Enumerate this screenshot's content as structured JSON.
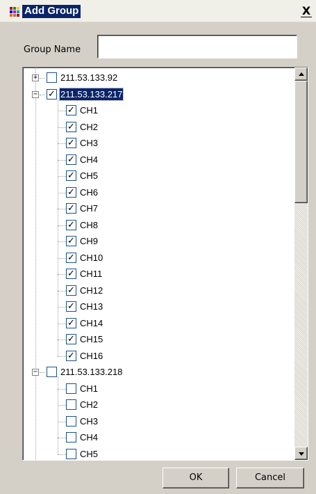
{
  "window": {
    "title": "Add Group",
    "close_label": "X"
  },
  "form": {
    "group_name_label": "Group Name",
    "group_name_value": ""
  },
  "tree": {
    "nodes": [
      {
        "label": "211.53.133.92",
        "expanded": false,
        "checked": false,
        "selected": false,
        "children": []
      },
      {
        "label": "211.53.133.217",
        "expanded": true,
        "checked": true,
        "selected": true,
        "children": [
          {
            "label": "CH1",
            "checked": true
          },
          {
            "label": "CH2",
            "checked": true
          },
          {
            "label": "CH3",
            "checked": true
          },
          {
            "label": "CH4",
            "checked": true
          },
          {
            "label": "CH5",
            "checked": true
          },
          {
            "label": "CH6",
            "checked": true
          },
          {
            "label": "CH7",
            "checked": true
          },
          {
            "label": "CH8",
            "checked": true
          },
          {
            "label": "CH9",
            "checked": true
          },
          {
            "label": "CH10",
            "checked": true
          },
          {
            "label": "CH11",
            "checked": true
          },
          {
            "label": "CH12",
            "checked": true
          },
          {
            "label": "CH13",
            "checked": true
          },
          {
            "label": "CH14",
            "checked": true
          },
          {
            "label": "CH15",
            "checked": true
          },
          {
            "label": "CH16",
            "checked": true
          }
        ]
      },
      {
        "label": "211.53.133.218",
        "expanded": true,
        "checked": false,
        "selected": false,
        "children": [
          {
            "label": "CH1",
            "checked": false
          },
          {
            "label": "CH2",
            "checked": false
          },
          {
            "label": "CH3",
            "checked": false
          },
          {
            "label": "CH4",
            "checked": false
          },
          {
            "label": "CH5",
            "checked": false
          }
        ]
      }
    ]
  },
  "buttons": {
    "ok_label": "OK",
    "cancel_label": "Cancel"
  }
}
